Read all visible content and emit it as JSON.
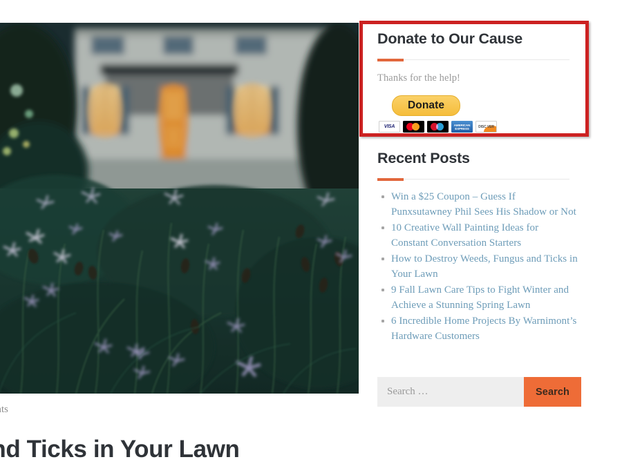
{
  "page": {
    "post_meta": "omments",
    "post_title": "Fungus and Ticks in Your Lawn",
    "featured_image_alt": "house-at-dusk-with-lit-windows-behind-wildflower-meadow"
  },
  "annotation": {
    "highlight_color": "#cc2222",
    "target": "donate-widget"
  },
  "sidebar": {
    "donate_widget": {
      "title": "Donate to Our Cause",
      "description": "Thanks for the help!",
      "button_label": "Donate",
      "button_color": "#f7c44a",
      "accent_color": "#e2673c",
      "cards": [
        {
          "name": "visa-card-icon",
          "label": "VISA"
        },
        {
          "name": "mastercard-card-icon",
          "label": ""
        },
        {
          "name": "maestro-card-icon",
          "label": ""
        },
        {
          "name": "amex-card-icon",
          "label": "AMERICAN EXPRESS"
        },
        {
          "name": "discover-card-icon",
          "label": "DISC VER"
        }
      ]
    },
    "recent_posts_widget": {
      "title": "Recent Posts",
      "accent_color": "#e2673c",
      "link_color": "#6d9cb8",
      "items": [
        {
          "label": "Win a $25 Coupon – Guess If Punxsutawney Phil Sees His Shadow or Not"
        },
        {
          "label": "10 Creative Wall Painting Ideas for Constant Conversation Starters"
        },
        {
          "label": "How to Destroy Weeds, Fungus and Ticks in Your Lawn"
        },
        {
          "label": "9 Fall Lawn Care Tips to Fight Winter and Achieve a Stunning Spring Lawn"
        },
        {
          "label": "6 Incredible Home Projects By Warnimont’s Hardware Customers"
        }
      ]
    },
    "search_widget": {
      "placeholder": "Search …",
      "value": "",
      "button_label": "Search",
      "button_color": "#ee6c37"
    }
  }
}
